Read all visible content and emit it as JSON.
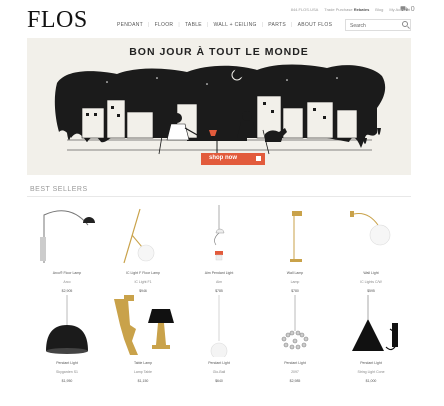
{
  "header": {
    "logo": "FLOS",
    "topbar": {
      "phone": "844.FLOS.USA",
      "trade": "Trade Purchase",
      "trade_bold": "Rebates",
      "blog": "Blog",
      "account": "My Account"
    },
    "cart_count": "0",
    "nav": [
      "PENDANT",
      "FLOOR",
      "TABLE",
      "WALL + CEILING",
      "PARTS",
      "ABOUT FLOS"
    ],
    "search_placeholder": "Search"
  },
  "hero": {
    "title": "BON JOUR À TOUT LE MONDE",
    "cta": "shop now"
  },
  "best_sellers": {
    "title": "BEST SELLERS",
    "products": [
      {
        "name": "Arco® Floor Lamp",
        "sub": "Arco",
        "price": "$2,905"
      },
      {
        "name": "IC Light F Floor Lamp",
        "sub": "IC Light F1",
        "price": "$946"
      },
      {
        "name": "Aim Pendant Light",
        "sub": "Aim",
        "price": "$785"
      },
      {
        "name": "Wall Lamp",
        "sub": "Lamp",
        "price": "$780"
      },
      {
        "name": "Wall Light",
        "sub": "IC Lights C/W",
        "price": "$595"
      },
      {
        "name": "Pendant Light",
        "sub": "Skygarden S1",
        "price": "$1,950"
      },
      {
        "name": "Table Lamp",
        "sub": "Lamp Table",
        "price": "$1,150"
      },
      {
        "name": "Pendant Light",
        "sub": "Glo-Ball",
        "price": "$640"
      },
      {
        "name": "Pendant Light",
        "sub": "2097",
        "price": "$2,985"
      },
      {
        "name": "Pendant Light",
        "sub": "String Light Cone",
        "price": "$1,000"
      }
    ]
  },
  "colors": {
    "accent": "#e25b3c",
    "hero_bg": "#f2f0ea",
    "brass": "#c9a24a"
  }
}
